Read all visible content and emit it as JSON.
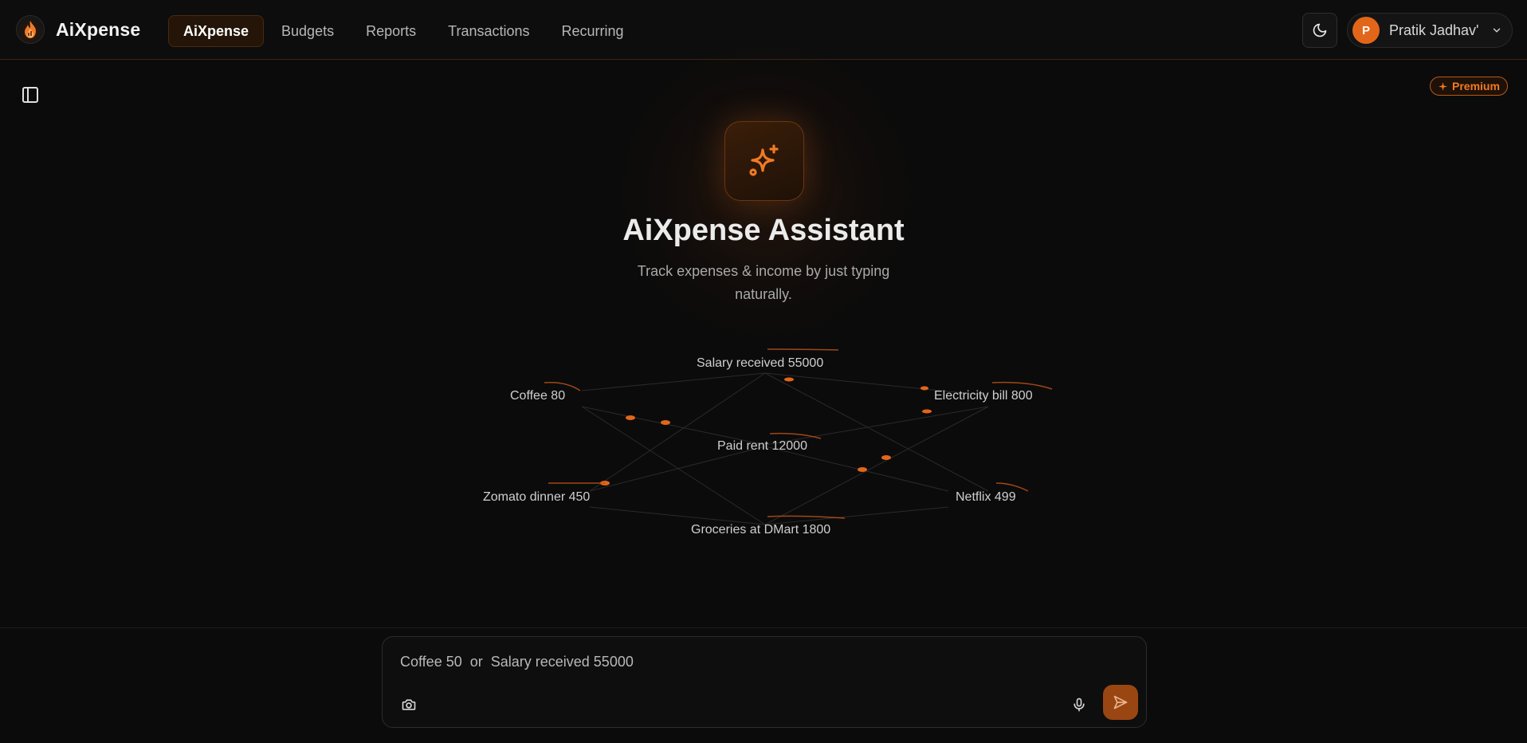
{
  "header": {
    "brand_name": "AiXpense",
    "nav": [
      {
        "label": "AiXpense",
        "active": true
      },
      {
        "label": "Budgets",
        "active": false
      },
      {
        "label": "Reports",
        "active": false
      },
      {
        "label": "Transactions",
        "active": false
      },
      {
        "label": "Recurring",
        "active": false
      }
    ],
    "theme_icon": "moon-icon",
    "user": {
      "initial": "P",
      "name": "Pratik Jadhav'"
    }
  },
  "badge": {
    "label": "Premium",
    "icon": "sparkle-icon"
  },
  "hero": {
    "icon": "sparkles-icon",
    "title": "AiXpense Assistant",
    "subtitle": "Track expenses & income by just typing naturally."
  },
  "examples": [
    "Salary received 55000",
    "Coffee 80",
    "Electricity bill 800",
    "Paid rent 12000",
    "Zomato dinner 450",
    "Netflix 499",
    "Groceries at DMart 1800"
  ],
  "composer": {
    "placeholder": "Coffee 50  or  Salary received 55000",
    "value": ""
  },
  "colors": {
    "accent": "#e2661a",
    "background": "#0b0b0b",
    "send_button": "#9a4612"
  }
}
